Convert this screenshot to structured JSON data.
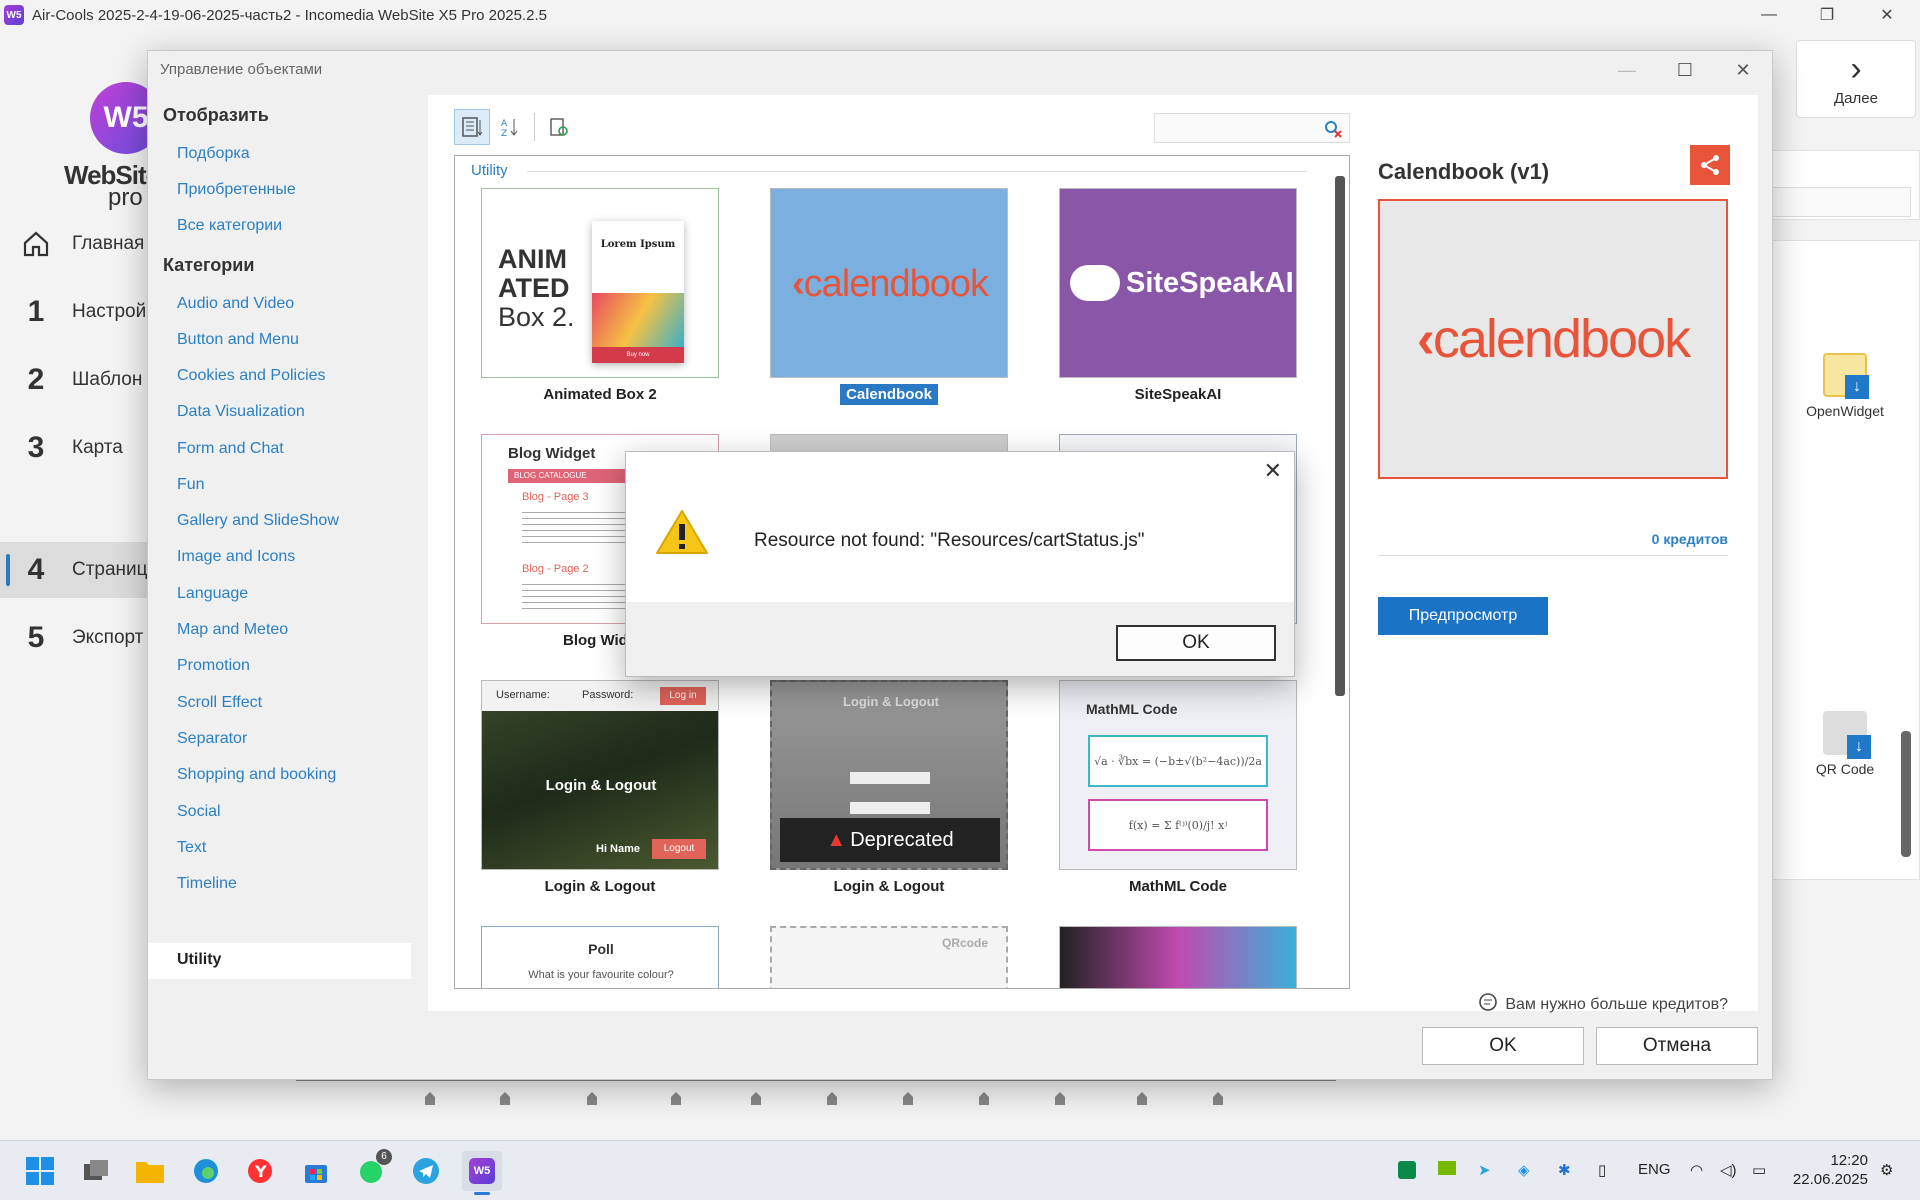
{
  "app": {
    "title": "Air-Cools 2025-2-4-19-06-2025-часть2 - Incomedia WebSite X5 Pro 2025.2.5",
    "logo_icon": "ws-logo-icon",
    "logo_mark": "W5",
    "logo_line1": "WebSite",
    "logo_line2": "pro",
    "steps": [
      {
        "num": "",
        "label": "Главная"
      },
      {
        "num": "1",
        "label": "Настрой"
      },
      {
        "num": "2",
        "label": "Шаблон"
      },
      {
        "num": "3",
        "label": "Карта"
      },
      {
        "num": "4",
        "label": "Страниц"
      },
      {
        "num": "5",
        "label": "Экспорт"
      }
    ],
    "next_label": "Далее",
    "next_partial": "д",
    "right_items": [
      {
        "label": "OpenWidget",
        "icon": "openwidget-icon"
      },
      {
        "label": "QR Code",
        "icon": "qr-code-icon"
      }
    ]
  },
  "dialog": {
    "title": "Управление объектами",
    "show_header": "Отобразить",
    "show_links": [
      "Подборка",
      "Приобретенные",
      "Все категории"
    ],
    "categories_header": "Категории",
    "categories": [
      "Audio and Video",
      "Button and Menu",
      "Cookies and Policies",
      "Data Visualization",
      "Form and Chat",
      "Fun",
      "Gallery and SlideShow",
      "Image and Icons",
      "Language",
      "Map and Meteo",
      "Promotion",
      "Scroll Effect",
      "Separator",
      "Shopping and booking",
      "Social",
      "Text",
      "Timeline"
    ],
    "selected_category": "Utility",
    "group_label": "Utility",
    "tiles": [
      {
        "caption": "Animated Box 2",
        "thumb_l1": "ANIM",
        "thumb_l2": "ATED",
        "thumb_l3": "Box 2.",
        "card_title": "Lorem Ipsum",
        "card_btn": "Buy now"
      },
      {
        "caption": "Calendbook",
        "thumb_text": "calendbook",
        "selected": true
      },
      {
        "caption": "SiteSpeakAI",
        "thumb_text": "SiteSpeakAI"
      },
      {
        "caption": "Blog Widg",
        "thumb_title": "Blog Widget",
        "thumb_sub": "BLOG CATALOGUE",
        "p1": "Blog - Page 3",
        "p2": "Blog - Page 2"
      },
      {
        "caption": "Login & Logout",
        "username": "Username:",
        "password": "Password:",
        "login_btn": "Log in",
        "center": "Login & Logout",
        "hi": "Hi Name",
        "logout": "Logout"
      },
      {
        "caption": "Login & Logout",
        "center": "Login & Logout",
        "badge": "Deprecated"
      },
      {
        "caption": "MathML Code",
        "thumb_title": "MathML Code"
      },
      {
        "caption": "",
        "thumb_title": "Poll",
        "question": "What is your favourite colour?"
      },
      {
        "caption": "",
        "thumb_title": "QRcode"
      },
      {
        "caption": ""
      }
    ],
    "detail": {
      "name": "Calendbook (v1)",
      "preview_text": "calendbook",
      "credits": "0 кредитов",
      "preview_button": "Предпросмотр",
      "more_credits": "Вам нужно больше кредитов?"
    },
    "ok": "OK",
    "cancel": "Отмена"
  },
  "alert": {
    "message": "Resource not found: \"Resources/cartStatus.js\"",
    "ok": "OK",
    "icon": "warning-icon"
  },
  "taskbar": {
    "lang": "ENG",
    "time": "12:20",
    "date": "22.06.2025",
    "whatsapp_badge": "6"
  },
  "colors": {
    "accent": "#2a79c4",
    "calendbook_bg": "#7aafe0",
    "calendbook_brand": "#e8543a",
    "sitespeak_bg": "#8a56a8"
  }
}
